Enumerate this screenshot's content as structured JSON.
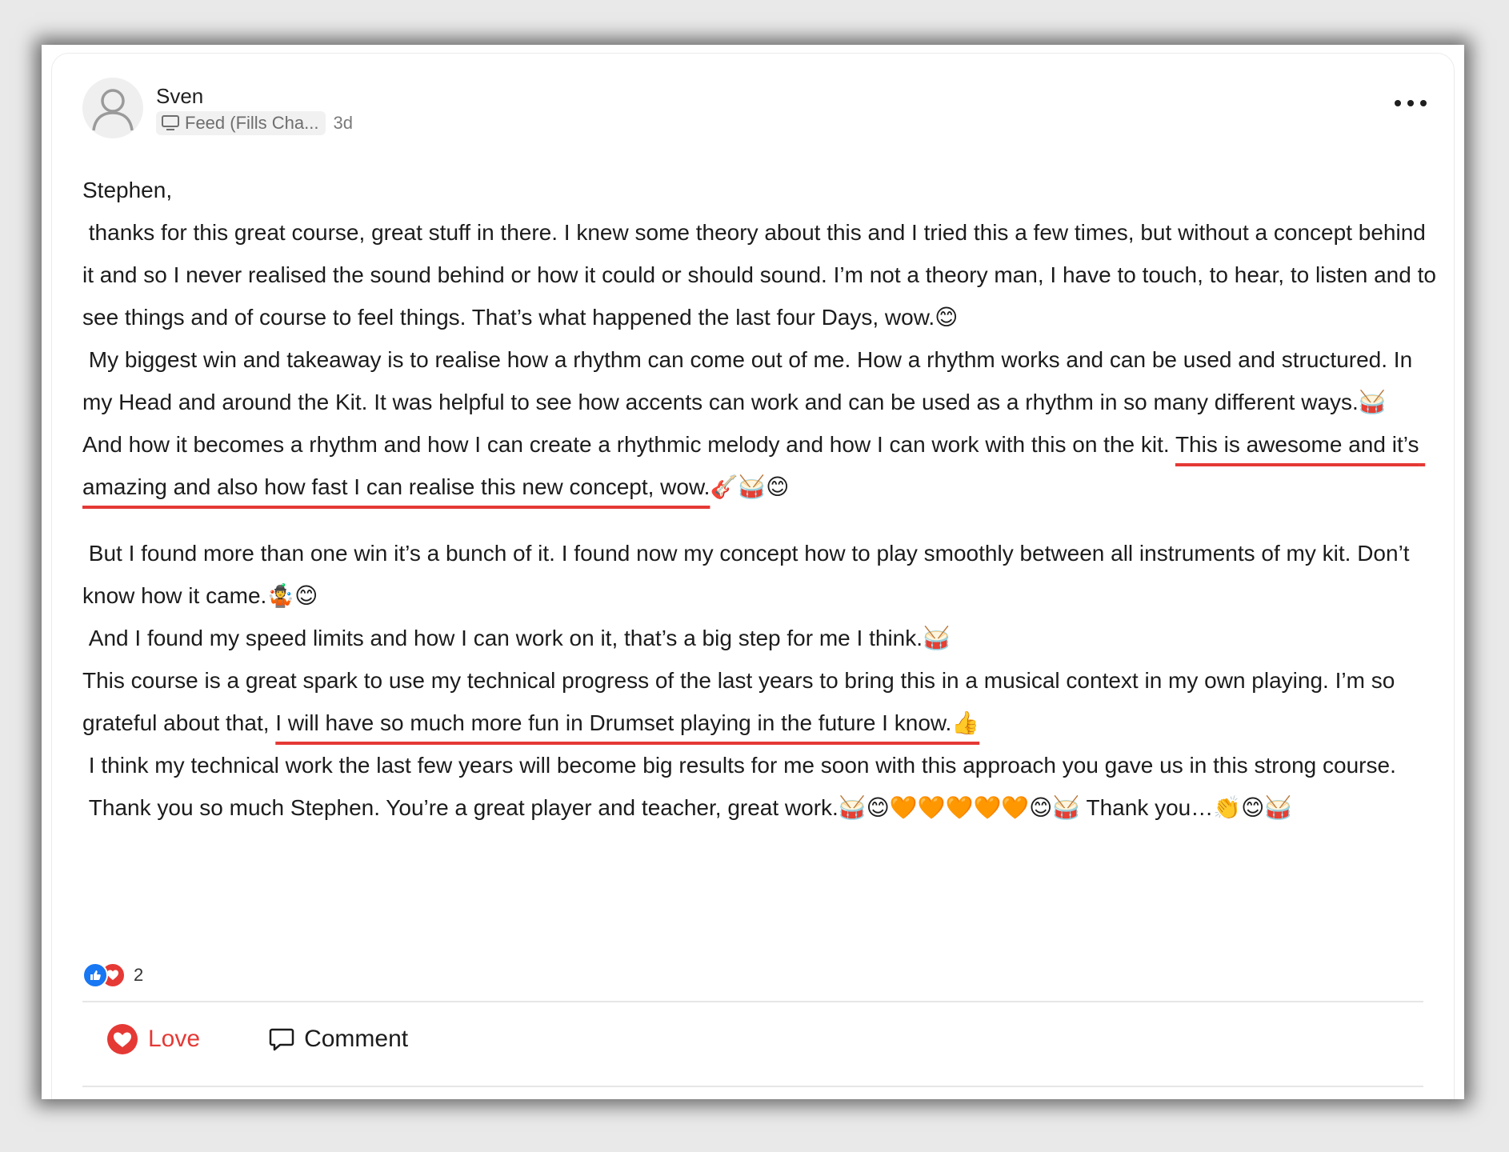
{
  "post": {
    "author": "Sven",
    "space": "Feed (Fills Cha...",
    "age": "3d",
    "paragraphs": [
      "Stephen,",
      " thanks for this great course, great stuff in there. I knew some theory about this and I tried this a few times, but without a concept behind it and so I never realised the sound behind or how it could or should sound. I’m not a theory man, I have to touch, to hear, to listen and to see things and of course to feel things. That’s what happened the last four Days, wow.😊",
      " My biggest win and takeaway is to realise how a rhythm can come out of me. How a rhythm works and can be used and structured. In my Head and around the Kit. It was helpful to see how accents can work and can be used as a rhythm in so many different ways.🥁"
    ],
    "p4_before": "And how it becomes a rhythm and how I can create a rhythmic melody and how I can work with this on the kit. ",
    "p4_highlight": "This is awesome and it’s amazing and also how fast I can realise this new concept, wow.",
    "p4_after": "🎸🥁😊",
    "p5": " But I found more than one win it’s a bunch of it. I found now my concept how to play smoothly between all instruments of my kit. Don’t know how it came.🤹😊",
    "p6": " And I found my speed limits and how I can work on it, that’s a big step for me I think.🥁",
    "p7_before": "This course is a great spark to use my technical progress of the last years to bring this in a musical context in my own playing. I’m so grateful about that, ",
    "p7_highlight": "I will have so much more fun in Drumset playing in the future I know.👍",
    "p8": " I think my technical work the last few years will become big results for me soon with this approach you gave us in this strong course.",
    "p9": " Thank you so much Stephen. You’re a great player and teacher, great work.🥁😊🧡🧡🧡🧡🧡😊🥁 Thank you…👏😊🥁"
  },
  "reactions": {
    "count": "2"
  },
  "actions": {
    "love_label": "Love",
    "comment_label": "Comment"
  },
  "colors": {
    "accent_red": "#e53935",
    "like_blue": "#1877f2"
  },
  "icons": {
    "more": "more-horizontal-icon",
    "space": "monitor-icon",
    "love": "heart-icon",
    "comment": "comment-icon"
  }
}
